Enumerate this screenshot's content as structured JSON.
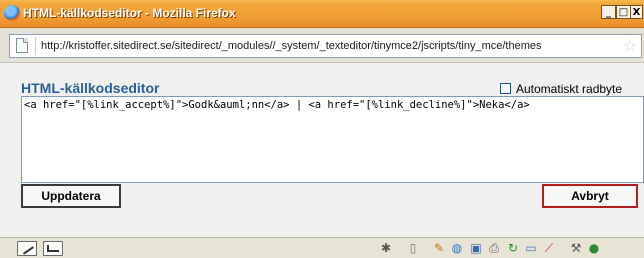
{
  "window": {
    "title": "HTML-källkodseditor - Mozilla Firefox",
    "icon": "firefox-icon",
    "controls": {
      "minimize": "_",
      "maximize": "□",
      "close": "X"
    }
  },
  "addressbar": {
    "url": "http://kristoffer.sitedirect.se/sitedirect/_modules//_system/_texteditor/tinymce2/jscripts/tiny_mce/themes",
    "page_icon": "page-icon",
    "star_icon": "star-icon",
    "star_glyph": "☆"
  },
  "editor": {
    "title": "HTML-källkodseditor",
    "autowrap_label": "Automatiskt radbyte",
    "autowrap_checked": false,
    "source": "<a href=\"[%link_accept%]\">Godk&auml;nn</a> | <a href=\"[%link_decline%]\">Neka</a>",
    "update_button": "Uppdatera",
    "cancel_button": "Avbryt"
  },
  "statusbar": {
    "left_icons": [
      "pencil-icon",
      "ruler-icon"
    ],
    "right_icons": [
      "extension-icon",
      "blank-page-icon",
      "edit-icon",
      "globe-icon",
      "save-icon",
      "print-icon",
      "refresh-icon",
      "window-icon",
      "chart-icon",
      "tools-icon",
      "info-icon"
    ],
    "colors": {
      "accent": "#2b5f9e",
      "cancel_border": "#b51e1e",
      "titlebar": "#f0a638"
    }
  }
}
